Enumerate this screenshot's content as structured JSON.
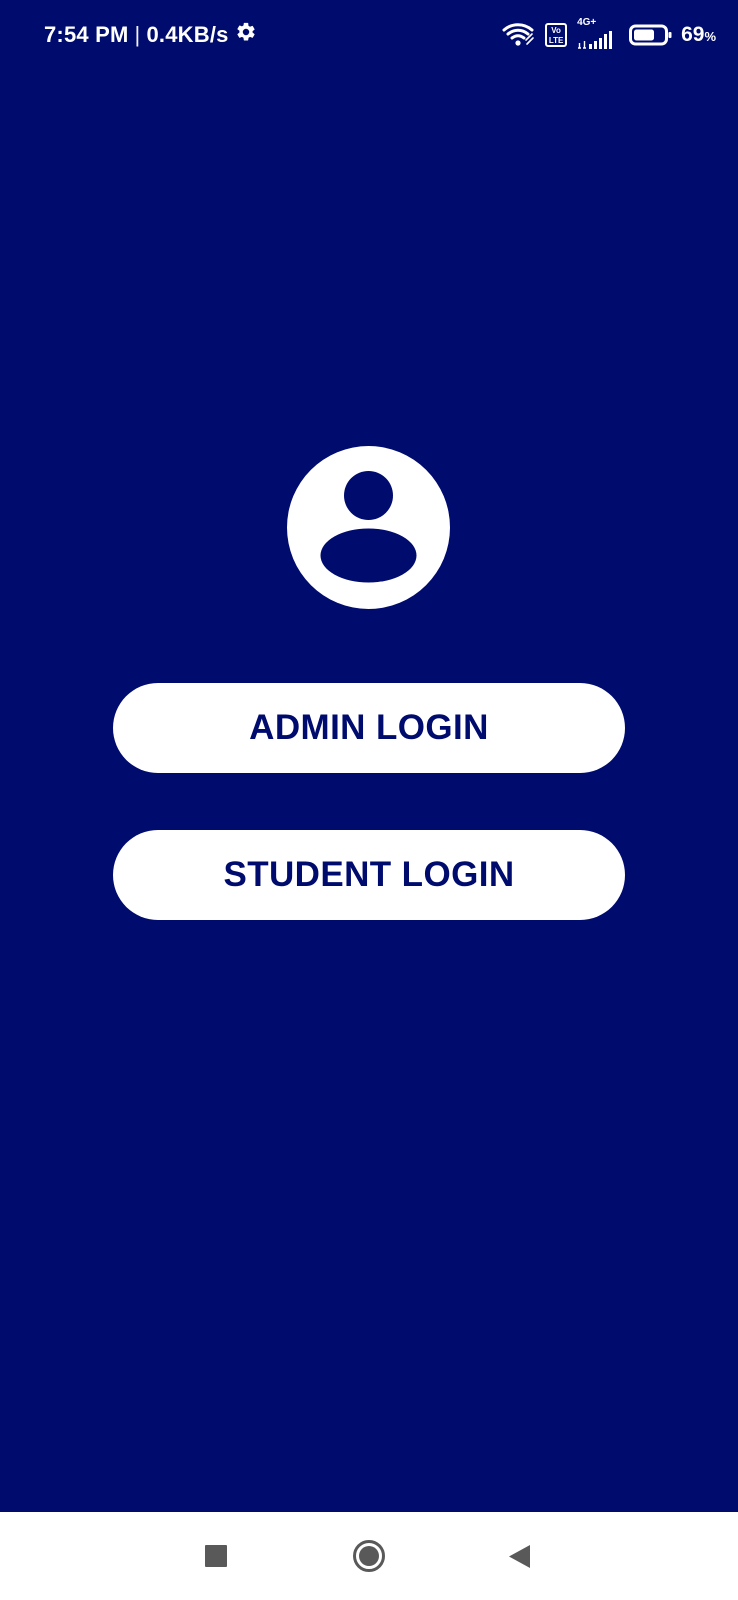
{
  "status_bar": {
    "time": "7:54 PM",
    "separator": "|",
    "network_speed": "0.4KB/s",
    "settings_icon": "gear-icon",
    "wifi_icon": "wifi-icon",
    "volte_text": "Vo LTE",
    "signal_icon": "signal-icon",
    "network_type": "4G+",
    "battery_level_text": "69",
    "battery_percent_sign": "%",
    "battery_fraction": 0.69
  },
  "main": {
    "avatar_icon": "user-avatar-icon",
    "admin_login_label": "ADMIN LOGIN",
    "student_login_label": "STUDENT LOGIN"
  },
  "colors": {
    "background": "#000b6e",
    "button_background": "#ffffff",
    "button_text": "#000b6e",
    "nav_background": "#ffffff",
    "nav_icon": "#595959"
  },
  "navigation_bar": {
    "recent_apps_icon": "square-icon",
    "home_icon": "home-circle-icon",
    "back_icon": "back-triangle-icon"
  }
}
